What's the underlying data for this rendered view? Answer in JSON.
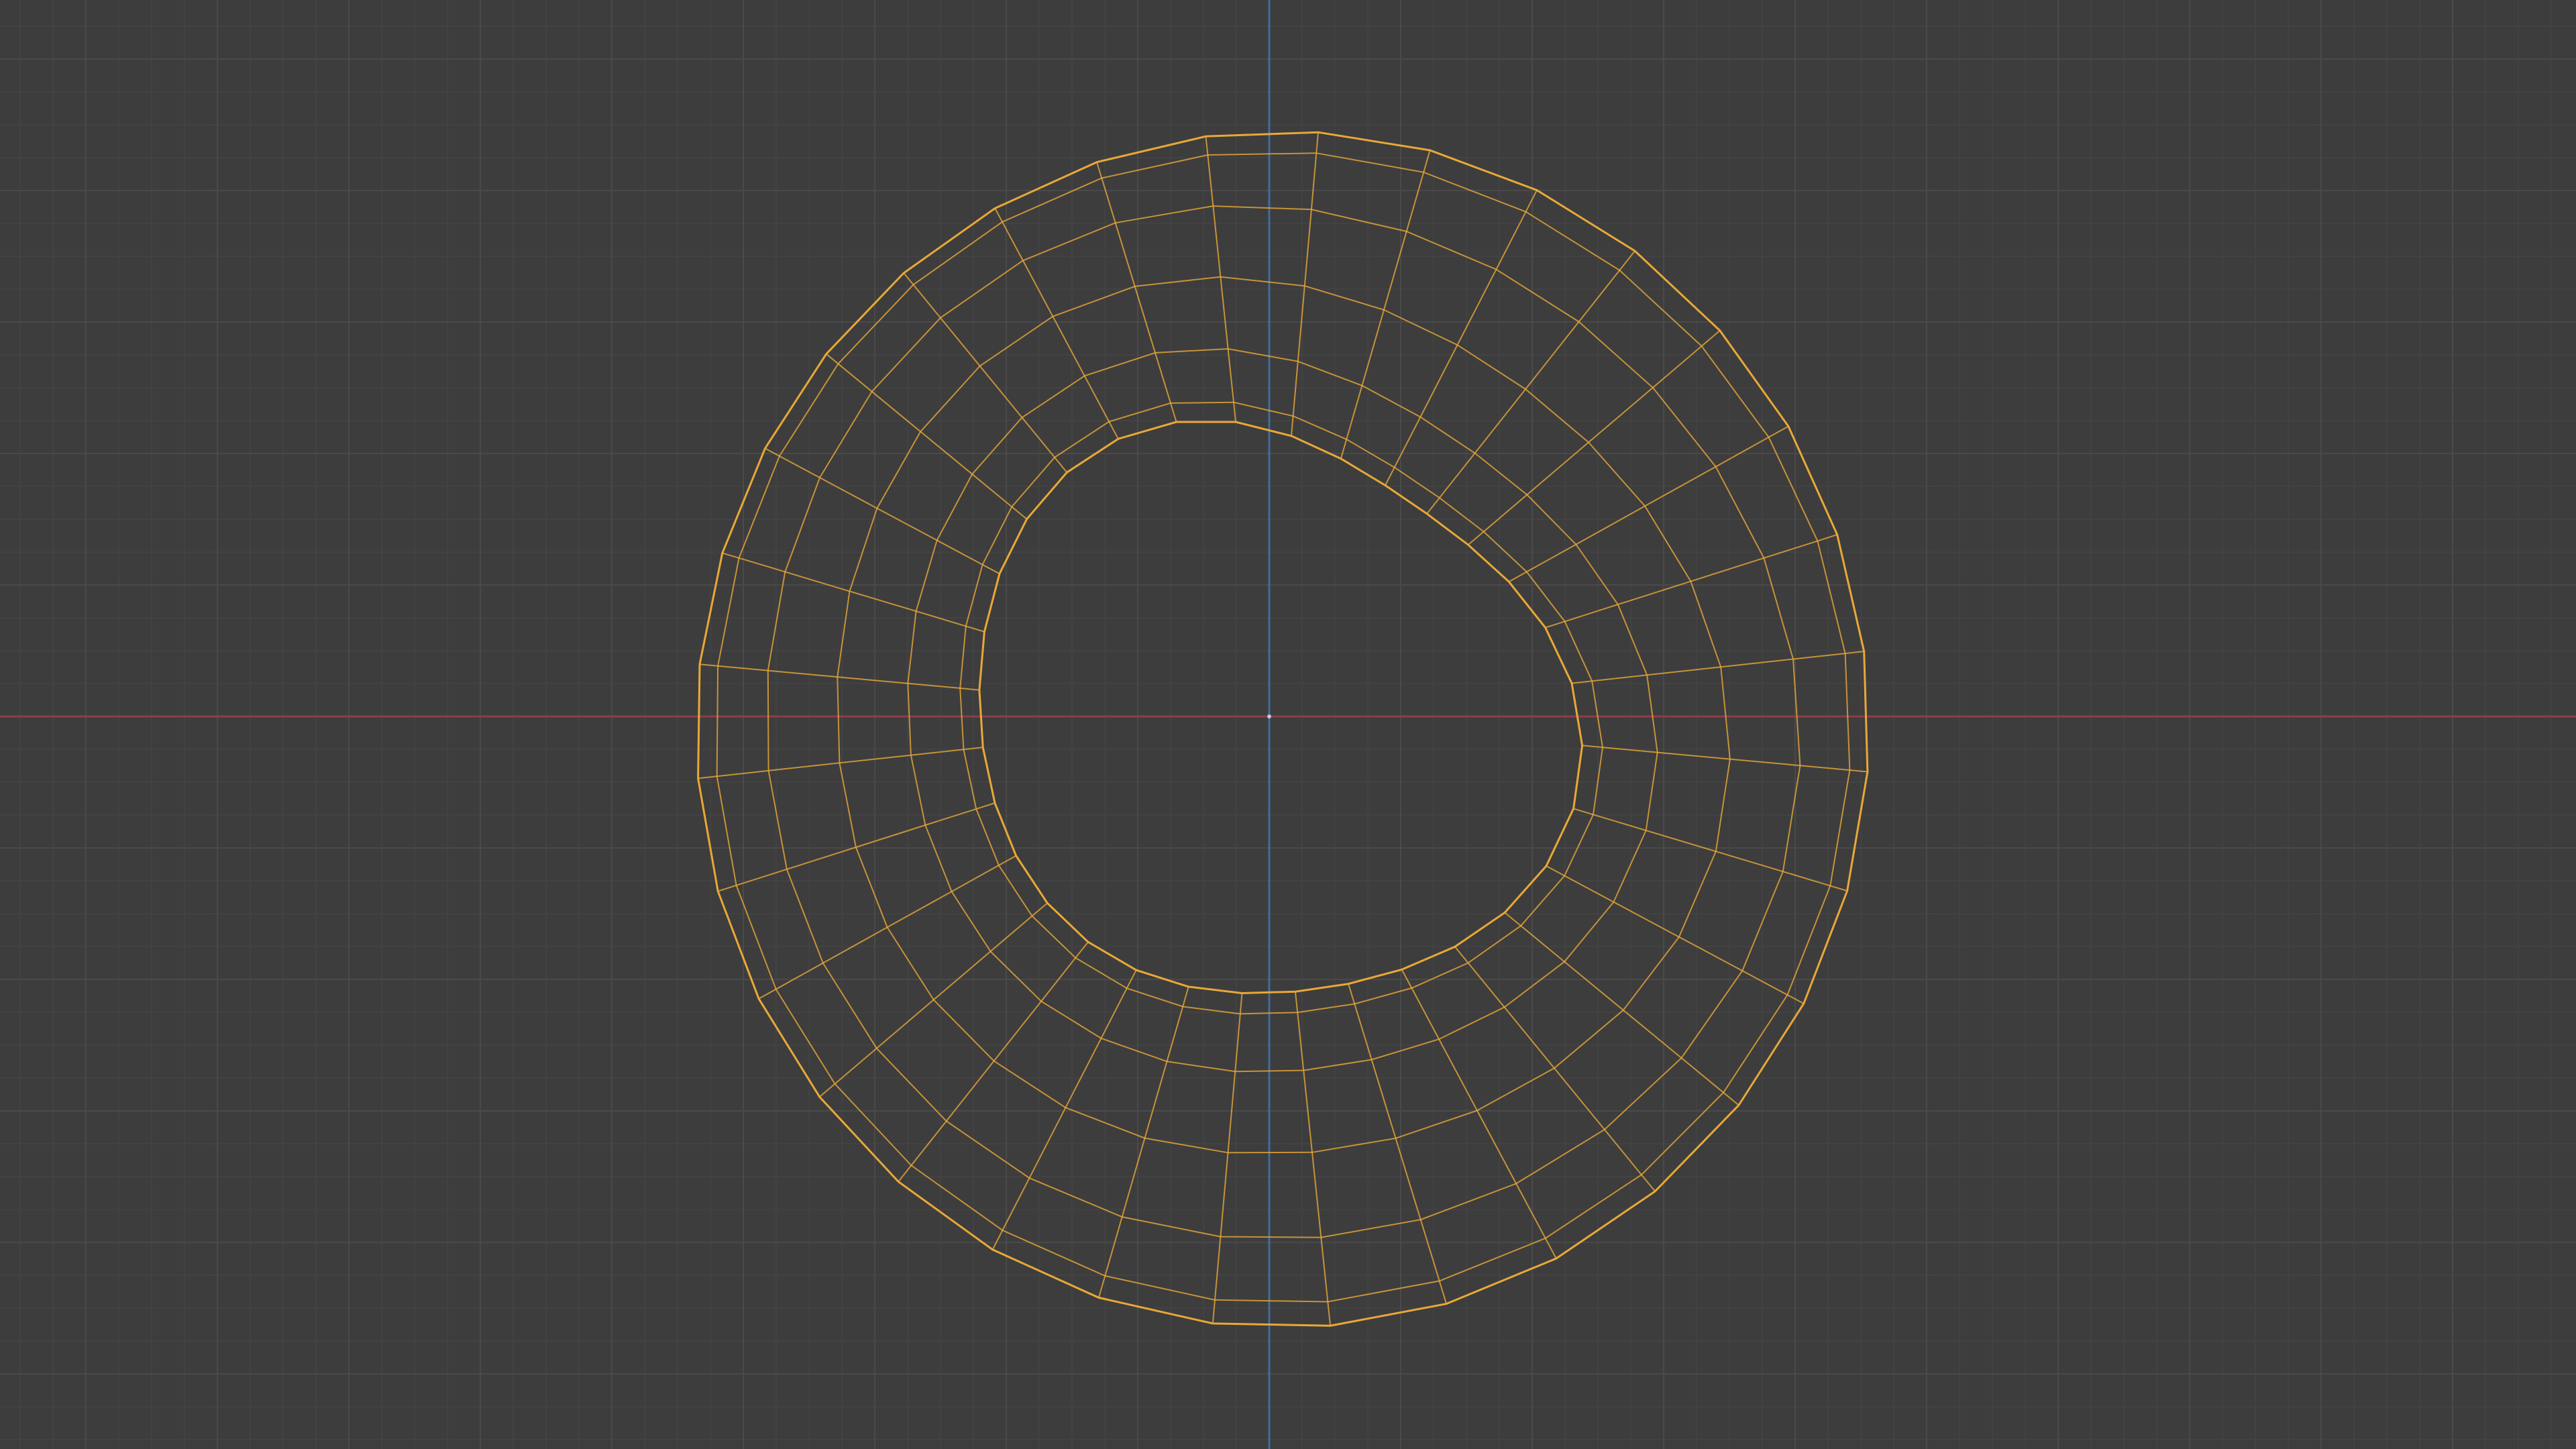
{
  "viewport": {
    "view": "top-orthographic",
    "background_color": "#3d3d3d",
    "grid": {
      "visible": true,
      "minor_color": "#454545",
      "major_color": "#4a4a4a"
    },
    "axes": {
      "x_axis_color": "#8f3d4a",
      "y_axis_color": "#3f6d9c"
    }
  },
  "mesh": {
    "object_type": "torus",
    "display_mode": "wireframe",
    "selected": true,
    "wire_color": "#e8a838",
    "major_segments": 32,
    "minor_segments": 12
  }
}
